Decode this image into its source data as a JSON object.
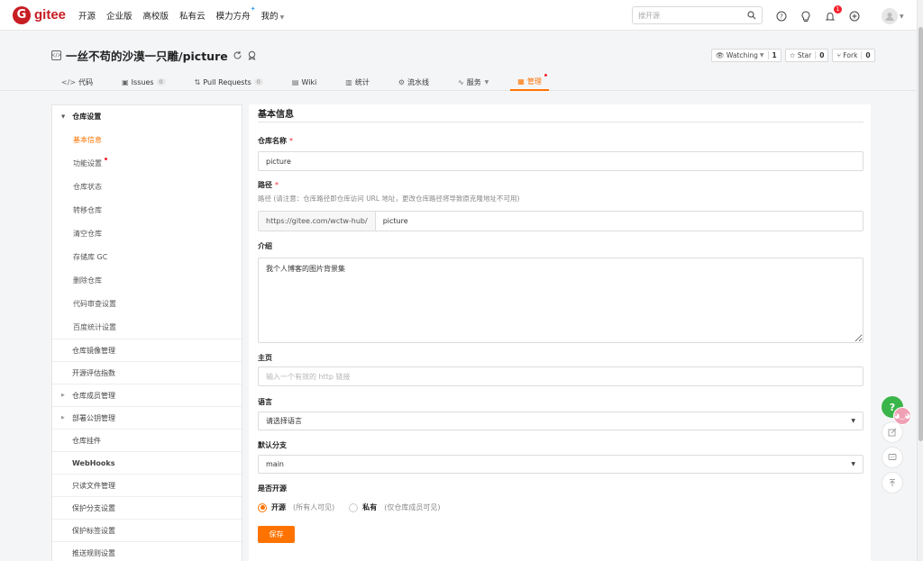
{
  "topnav": {
    "logo_text": "gitee",
    "links": [
      "开源",
      "企业版",
      "高校版",
      "私有云",
      "模力方舟",
      "我的"
    ],
    "search_placeholder": "搜开源",
    "notification_count": "1"
  },
  "repo": {
    "name": "一丝不苟的沙漠一只雕/picture",
    "watch_label": "Watching",
    "watch_count": "1",
    "star_label": "Star",
    "star_count": "0",
    "fork_label": "Fork",
    "fork_count": "0",
    "tabs": [
      {
        "label": "代码",
        "icon": "code-icon"
      },
      {
        "label": "Issues",
        "count": "0"
      },
      {
        "label": "Pull Requests",
        "count": "0"
      },
      {
        "label": "Wiki"
      },
      {
        "label": "统计"
      },
      {
        "label": "流水线"
      },
      {
        "label": "服务"
      },
      {
        "label": "管理"
      }
    ]
  },
  "sidebar": {
    "group_title": "仓库设置",
    "sub_items": [
      "基本信息",
      "功能设置",
      "仓库状态",
      "转移仓库",
      "清空仓库",
      "存储库 GC",
      "删除仓库",
      "代码审查设置",
      "百度统计设置"
    ],
    "items": [
      "仓库镜像管理",
      "开源评估指数",
      "仓库成员管理",
      "部署公钥管理",
      "仓库挂件",
      "WebHooks",
      "只读文件管理",
      "保护分支设置",
      "保护标签设置",
      "推送规则设置"
    ]
  },
  "form": {
    "section_title": "基本信息",
    "name_label": "仓库名称",
    "name_value": "picture",
    "path_label": "路径",
    "path_hint": "路径 (请注意：仓库路径即仓库访问 URL 地址，更改仓库路径将导致原克隆地址不可用)",
    "path_prefix": "https://gitee.com/wctw-hub/",
    "path_value": "picture",
    "intro_label": "介绍",
    "intro_value": "我个人博客的图片背景集",
    "homepage_label": "主页",
    "homepage_placeholder": "输入一个有效的 http 链接",
    "language_label": "语言",
    "language_value": "请选择语言",
    "branch_label": "默认分支",
    "branch_value": "main",
    "open_source_label": "是否开源",
    "open_option_label": "开源",
    "open_option_hint": "(所有人可见)",
    "private_option_label": "私有",
    "private_option_hint": "(仅仓库成员可见)",
    "save_label": "保存"
  },
  "float": {
    "help_label": "?"
  },
  "colors": {
    "accent": "#fe7300",
    "brand": "#c71d23",
    "required": "#f5222d"
  }
}
